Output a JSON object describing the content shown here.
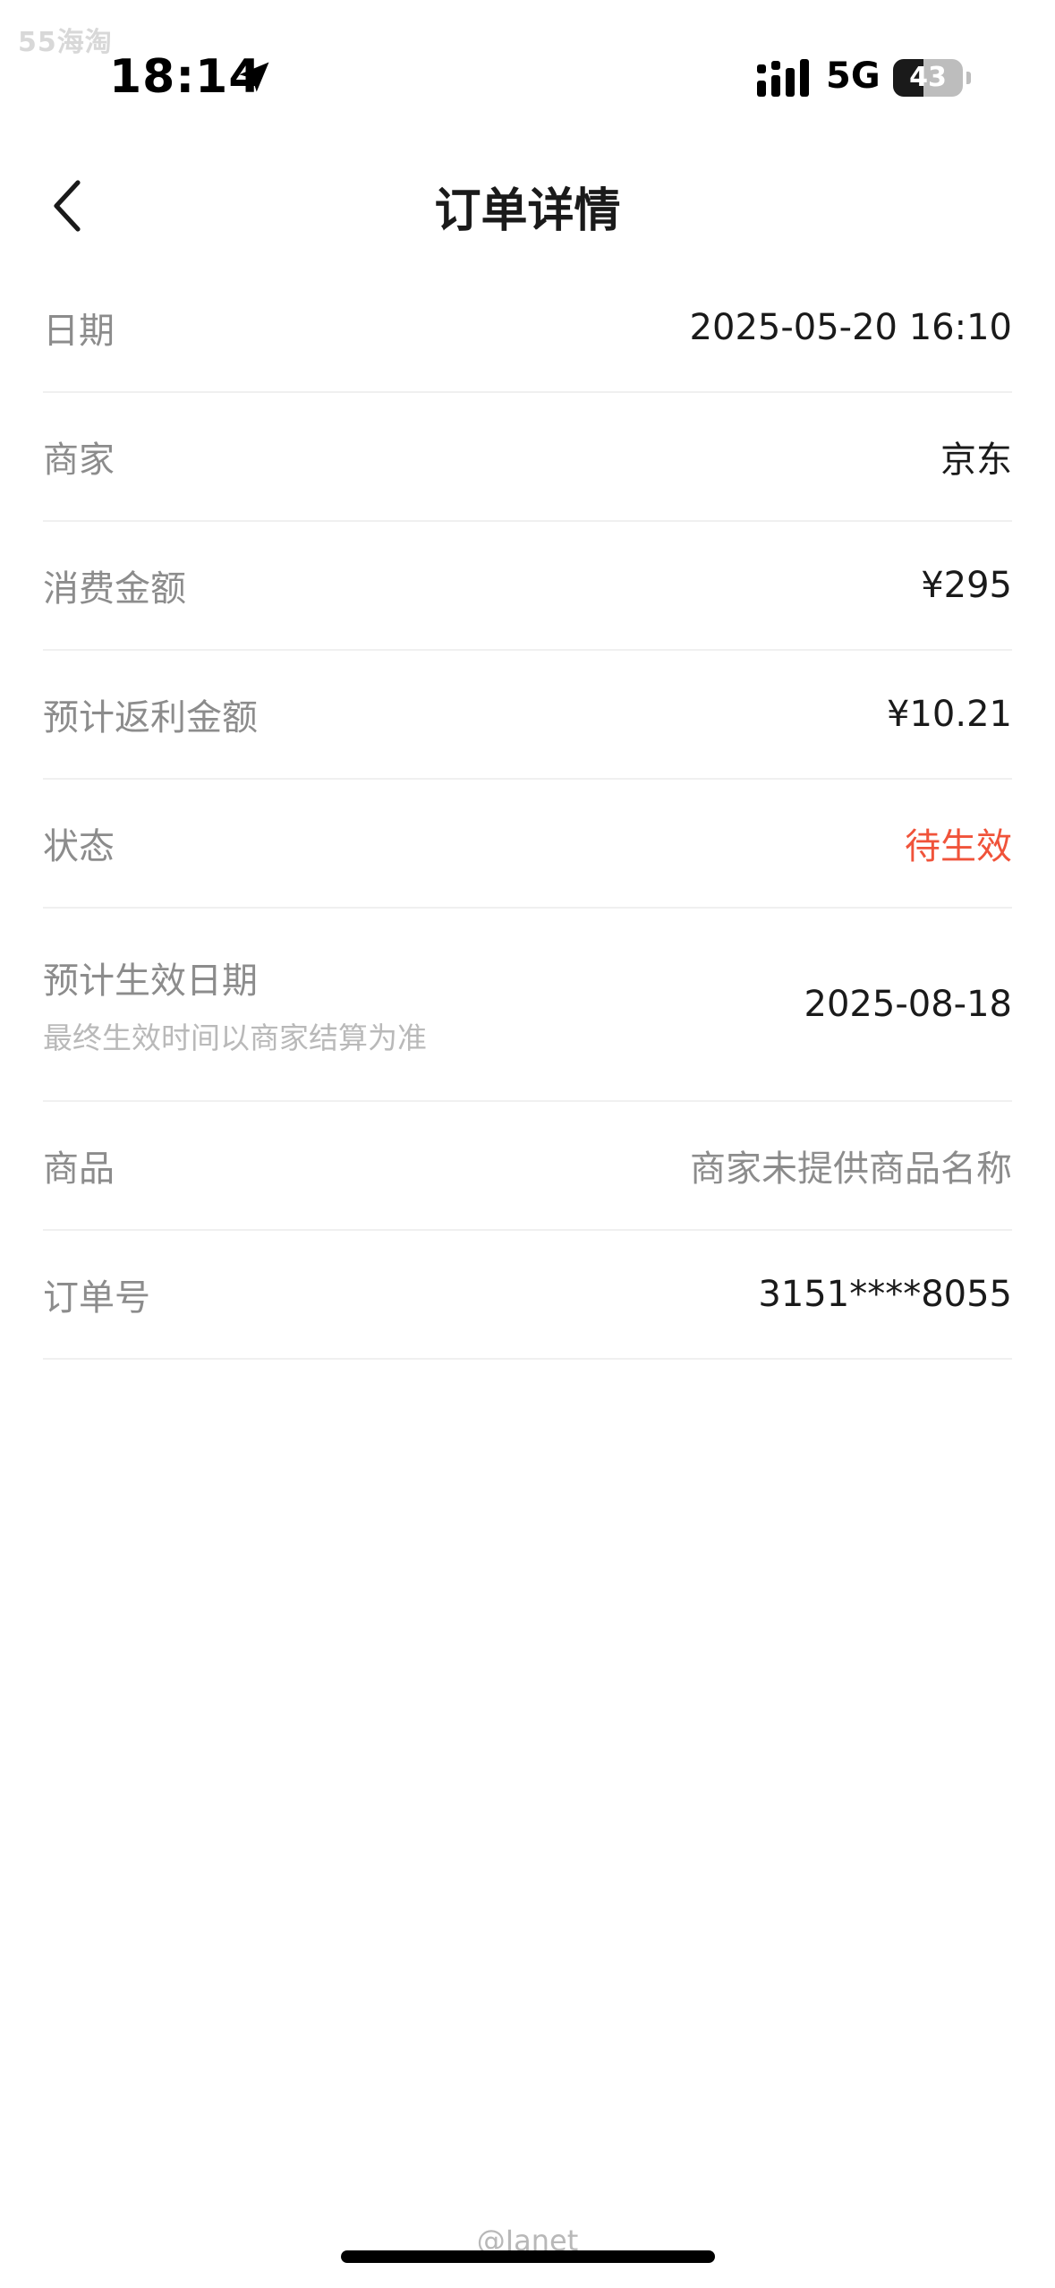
{
  "watermark_top": "55海淘",
  "status_bar": {
    "time": "18:14",
    "network": "5G",
    "battery_level": "43",
    "battery_percent": 43
  },
  "header": {
    "title": "订单详情",
    "back_icon": "chevron-left-icon"
  },
  "details": {
    "date": {
      "label": "日期",
      "value": "2025-05-20 16:10"
    },
    "merchant": {
      "label": "商家",
      "value": "京东"
    },
    "amount": {
      "label": "消费金额",
      "value": "¥295"
    },
    "rebate": {
      "label": "预计返利金额",
      "value": "¥10.21"
    },
    "status": {
      "label": "状态",
      "value": "待生效"
    },
    "effective_date": {
      "label": "预计生效日期",
      "sublabel": "最终生效时间以商家结算为准",
      "value": "2025-08-18"
    },
    "product": {
      "label": "商品",
      "value": "商家未提供商品名称"
    },
    "order_no": {
      "label": "订单号",
      "value": "3151****8055"
    }
  },
  "watermark_bottom": "@Janet",
  "colors": {
    "accent": "#f0533a",
    "label_gray": "#8c8c8c",
    "divider": "#f0f0f0"
  }
}
